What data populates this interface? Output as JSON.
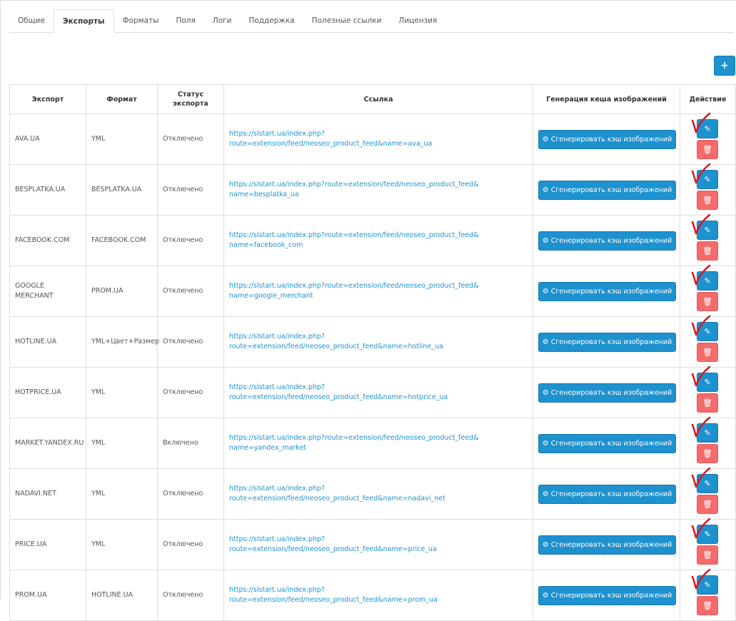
{
  "tabs": [
    {
      "label": "Общие",
      "active": false
    },
    {
      "label": "Экспорты",
      "active": true
    },
    {
      "label": "Форматы",
      "active": false
    },
    {
      "label": "Поля",
      "active": false
    },
    {
      "label": "Логи",
      "active": false
    },
    {
      "label": "Поддержка",
      "active": false
    },
    {
      "label": "Полезные ссылки",
      "active": false
    },
    {
      "label": "Лицензия",
      "active": false
    }
  ],
  "add_button": {
    "label": "+",
    "icon": "plus-icon"
  },
  "table": {
    "headers": {
      "export": "Экспорт",
      "format": "Формат",
      "status": "Статус экспорта",
      "link": "Ссылка",
      "cache": "Генерация кеша изображений",
      "action": "Действие"
    },
    "generate_label": "Сгенерировать кэш изображений",
    "rows": [
      {
        "export": "AVA.UA",
        "format": "YML",
        "status": "Отключено",
        "link": "https://slstart.ua/index.php?route=extension/feed/neoseo_product_feed&name=ava_ua"
      },
      {
        "export": "BESPLATKA.UA",
        "format": "BESPLATKA.UA",
        "status": "Отключено",
        "link": "https://slstart.ua/index.php?route=extension/feed/neoseo_product_feed& name=besplatka_ua"
      },
      {
        "export": "FACEBOOK.COM",
        "format": "FACEBOOK.COM",
        "status": "Отключено",
        "link": "https://slstart.ua/index.php?route=extension/feed/neoseo_product_feed& name=facebook_com"
      },
      {
        "export": "GOOGLE MERCHANT",
        "format": "PROM.UA",
        "status": "Отключено",
        "link": "https://slstart.ua/index.php?route=extension/feed/neoseo_product_feed& name=google_merchant"
      },
      {
        "export": "HOTLINE.UA",
        "format": "YML+Цвет+Размер",
        "status": "Отключено",
        "link": "https://slstart.ua/index.php?route=extension/feed/neoseo_product_feed&name=hotline_ua"
      },
      {
        "export": "HOTPRICE.UA",
        "format": "YML",
        "status": "Отключено",
        "link": "https://slstart.ua/index.php?route=extension/feed/neoseo_product_feed&name=hotprice_ua"
      },
      {
        "export": "MARKET.YANDEX.RU",
        "format": "YML",
        "status": "Включено",
        "link": "https://slstart.ua/index.php?route=extension/feed/neoseo_product_feed& name=yandex_market"
      },
      {
        "export": "NADAVI.NET",
        "format": "YML",
        "status": "Отключено",
        "link": "https://slstart.ua/index.php?route=extension/feed/neoseo_product_feed&name=nadavi_net"
      },
      {
        "export": "PRICE.UA",
        "format": "YML",
        "status": "Отключено",
        "link": "https://slstart.ua/index.php?route=extension/feed/neoseo_product_feed&name=price_ua"
      },
      {
        "export": "PROM.UA",
        "format": "HOTLINE.UA",
        "status": "Отключено",
        "link": "https://slstart.ua/index.php?route=extension/feed/neoseo_product_feed&name=prom_ua"
      }
    ]
  },
  "colors": {
    "primary": "#1e91cf",
    "danger": "#f56b6b",
    "check_mark": "#d21f26"
  }
}
